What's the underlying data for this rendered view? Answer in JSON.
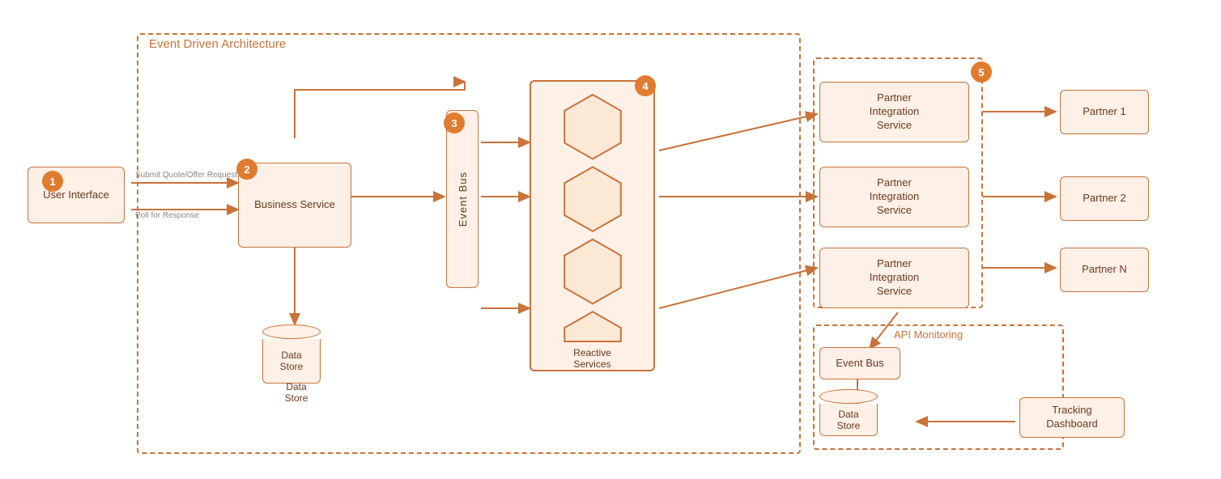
{
  "diagram": {
    "title": "Event Driven Architecture",
    "nodes": {
      "user_interface": {
        "label": "User Interface",
        "badge": "1"
      },
      "business_service": {
        "label": "Business Service",
        "badge": "2"
      },
      "event_bus": {
        "label": "Event Bus",
        "badge": "3"
      },
      "reactive_services": {
        "label": "Reactive\nServices",
        "badge": "4"
      },
      "partner_integration": {
        "label": "Partner Integration Service",
        "badge": "5"
      },
      "partner1": {
        "label": "Partner 1"
      },
      "partner2": {
        "label": "Partner 2"
      },
      "partnerN": {
        "label": "Partner N"
      },
      "data_store_main": {
        "label": "Data\nStore"
      },
      "data_store_api": {
        "label": "Data\nStore"
      },
      "event_bus_api": {
        "label": "Event Bus"
      },
      "tracking_dashboard": {
        "label": "Tracking\nDashboard"
      },
      "api_monitoring": {
        "label": "API Monitoring"
      },
      "partner_int_1": {
        "label": "Partner\nIntegration\nService"
      },
      "partner_int_2": {
        "label": "Partner\nIntegration\nService"
      },
      "partner_int_3": {
        "label": "Partner\nIntegration\nService"
      }
    },
    "arrows": {
      "submit_label": "Submit Quote/Offer Request",
      "poll_label": "Poll for Response"
    },
    "colors": {
      "orange": "#c8733a",
      "bg": "#fdf0e6",
      "badge": "#e07c30",
      "text": "#6b3a1f"
    }
  }
}
